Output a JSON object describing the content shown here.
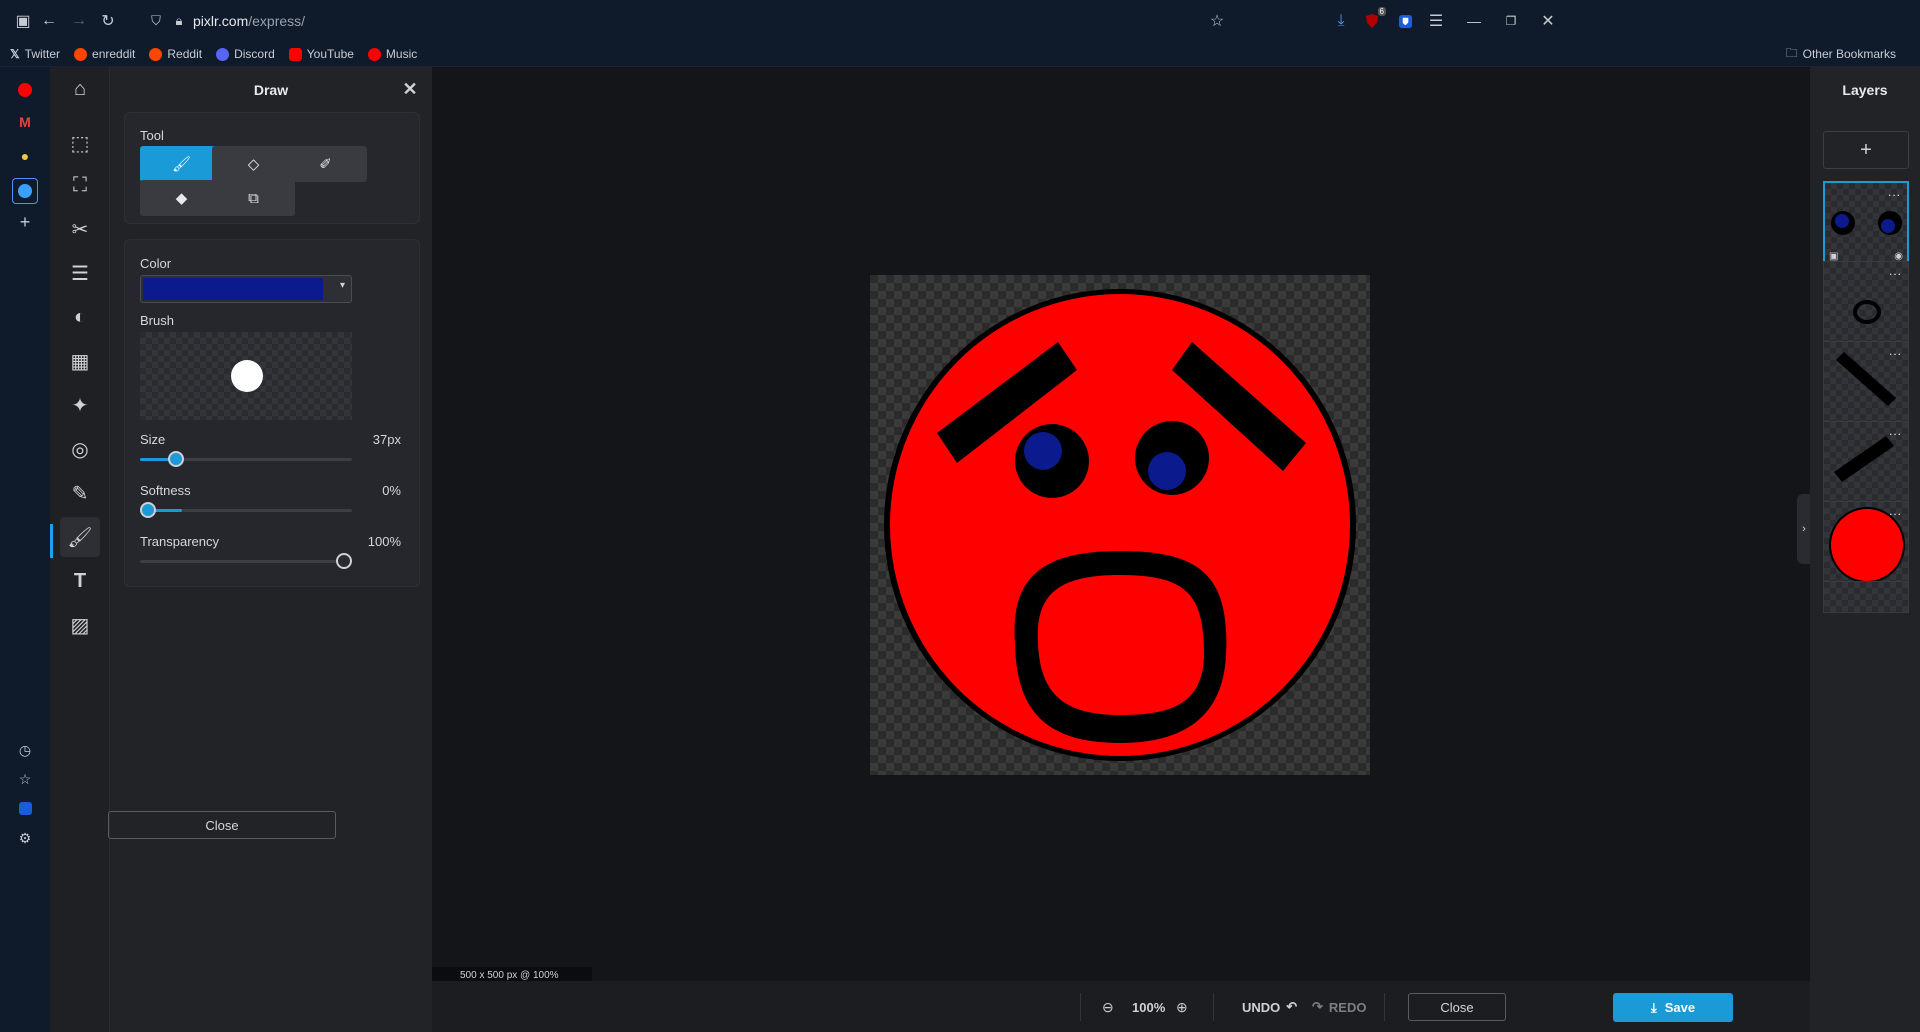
{
  "browser": {
    "url_host": "pixlr.com",
    "url_path": "/express/",
    "bookmarks": [
      {
        "label": "Twitter",
        "color": "#ffffff"
      },
      {
        "label": "enreddit",
        "color": "#ff4500"
      },
      {
        "label": "Reddit",
        "color": "#ff4500"
      },
      {
        "label": "Discord",
        "color": "#5865f2"
      },
      {
        "label": "YouTube",
        "color": "#ff0000"
      },
      {
        "label": "Music",
        "color": "#ff0000"
      }
    ],
    "other_bookmarks": "Other Bookmarks",
    "downloads_badge": "6"
  },
  "panel": {
    "title": "Draw",
    "tool_label": "Tool",
    "color_label": "Color",
    "color_value": "#0b1a8c",
    "brush_label": "Brush",
    "size_label": "Size",
    "size_value": "37px",
    "size_fraction": 0.17,
    "softness_label": "Softness",
    "softness_value": "0%",
    "softness_fraction": 0.0,
    "transparency_label": "Transparency",
    "transparency_value": "100%",
    "transparency_fraction": 1.0,
    "close_label": "Close"
  },
  "workspace": {
    "doc_info": "500 x 500 px @ 100%"
  },
  "bottombar": {
    "zoom": "100%",
    "undo": "UNDO",
    "redo": "REDO",
    "close": "Close",
    "save": "Save"
  },
  "layers": {
    "title": "Layers",
    "add": "+",
    "menu": "..."
  },
  "colors": {
    "accent": "#1a9ad6",
    "face": "#ff0000",
    "eye_pupil": "#0b1a8c"
  }
}
